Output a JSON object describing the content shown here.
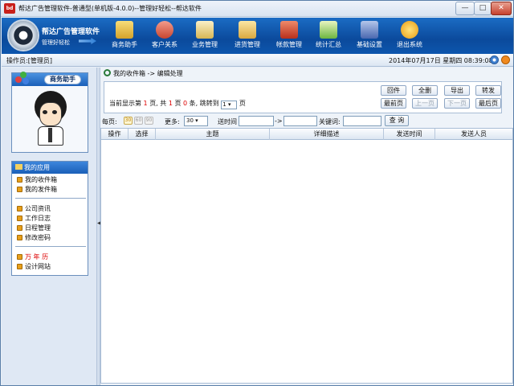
{
  "window": {
    "title": "帮达广告管理软件-普通型(单机版-4.0.0)--管理好轻松--帮达软件",
    "app_icon_text": "bd",
    "minimize": "—",
    "maximize": "□",
    "close": "✕"
  },
  "brand": {
    "name": "帮达广告管理软件",
    "slogan": "管理好轻松"
  },
  "nav": [
    {
      "label": "商务助手",
      "icon": "briefcase-pen-icon",
      "color": "#f0c040"
    },
    {
      "label": "客户关系",
      "icon": "people-icon",
      "color": "#e06050"
    },
    {
      "label": "业务管理",
      "icon": "clipboard-icon",
      "color": "#e8c860"
    },
    {
      "label": "进货管理",
      "icon": "box-icon",
      "color": "#f2d070"
    },
    {
      "label": "帐款管理",
      "icon": "money-arrow-icon",
      "color": "#d04030"
    },
    {
      "label": "统计汇总",
      "icon": "chart-icon",
      "color": "#60b040"
    },
    {
      "label": "基础设置",
      "icon": "book-icon",
      "color": "#6080c0"
    },
    {
      "label": "退出系统",
      "icon": "exit-icon",
      "color": "#f0b020"
    }
  ],
  "statusbar": {
    "operator": "操作员:[管理员]",
    "date": "2014年07月17日  星期四  08:39:08"
  },
  "sidebar": {
    "helper_title": "商务助手",
    "apps_title": "我的应用",
    "group1": [
      "我的收件箱",
      "我的发件箱"
    ],
    "group2": [
      "公司资讯",
      "工作日志",
      "日程管理",
      "修改密码"
    ],
    "group3": [
      {
        "label": "万 年 历",
        "highlight": true
      },
      {
        "label": "设计网站",
        "highlight": false
      }
    ]
  },
  "main": {
    "breadcrumb": "我的收件箱 -> 编辑处理",
    "pager": {
      "prefix": "当前显示第",
      "current_page": "1",
      "mid1": "页, 共",
      "total_pages": "1",
      "mid2": "页",
      "total_count": "0",
      "suffix": "条,  跳转到",
      "jump_value": "1",
      "jump_suffix": "页"
    },
    "buttons_top": [
      "回件",
      "全删",
      "导出",
      "转发"
    ],
    "buttons_nav": [
      {
        "label": "最前页",
        "disabled": false
      },
      {
        "label": "上一页",
        "disabled": true
      },
      {
        "label": "下一页",
        "disabled": true
      },
      {
        "label": "最后页",
        "disabled": false
      }
    ],
    "filter": {
      "per_page_label": "每页:",
      "sizes": [
        {
          "label": "30",
          "active": true
        },
        {
          "label": "60",
          "active": false
        },
        {
          "label": "90",
          "active": false
        }
      ],
      "more_label": "更多:",
      "more_value": "30",
      "time_label": "送时间",
      "range_sep": "->",
      "keyword_label": "关键词:",
      "query_button": "查 询"
    },
    "table": {
      "columns": [
        "操作",
        "选择",
        "主题",
        "详细描述",
        "发送时间",
        "发送人员"
      ]
    }
  }
}
